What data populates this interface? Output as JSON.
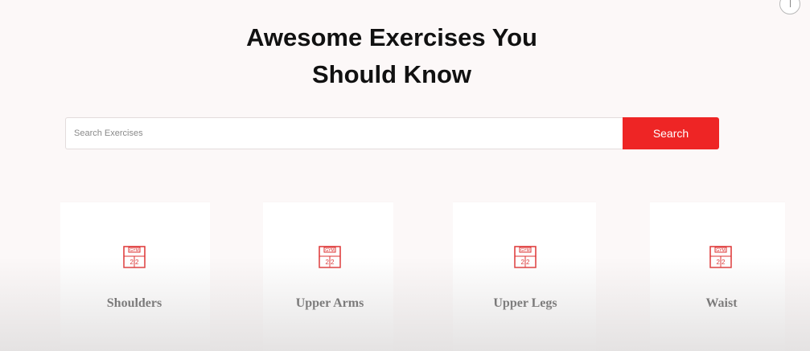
{
  "title": {
    "line1": "Awesome Exercises You",
    "line2": "Should Know"
  },
  "search": {
    "placeholder": "Search Exercises",
    "value": "",
    "button_label": "Search"
  },
  "categories": [
    {
      "label": "Shoulders",
      "icon": "gym-icon"
    },
    {
      "label": "Upper Arms",
      "icon": "gym-icon"
    },
    {
      "label": "Upper Legs",
      "icon": "gym-icon"
    },
    {
      "label": "Waist",
      "icon": "gym-icon"
    }
  ],
  "colors": {
    "accent": "#ee2525",
    "background": "#fcf8f8"
  }
}
